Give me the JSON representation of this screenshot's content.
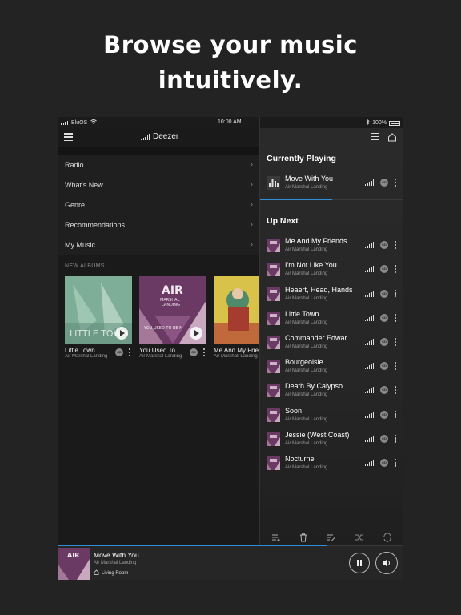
{
  "headline": {
    "line1": "Browse your music",
    "line2": "intuitively."
  },
  "status_bar": {
    "carrier": "BluOS",
    "time": "10:00 AM",
    "battery": "100%"
  },
  "left_panel": {
    "title": "Deezer",
    "menu": [
      {
        "label": "Radio"
      },
      {
        "label": "What's New"
      },
      {
        "label": "Genre"
      },
      {
        "label": "Recommendations"
      },
      {
        "label": "My Music"
      }
    ],
    "new_albums_label": "NEW ALBUMS",
    "albums": [
      {
        "title": "Little Town",
        "artist": "Air Marshal Landing",
        "art_color": "#8fb8a0"
      },
      {
        "title": "You Used To ...",
        "artist": "Air Marshal Landing",
        "art_color": "#8a4a7a"
      },
      {
        "title": "Me And My Frien",
        "artist": "Air Marshall Landing",
        "art_color": "#d8c24a"
      }
    ]
  },
  "right_panel": {
    "currently_playing_label": "Currently Playing",
    "current_track": {
      "name": "Move With You",
      "artist": "Air Marshal Landing"
    },
    "up_next_label": "Up Next",
    "queue": [
      {
        "name": "Me And My Friends",
        "artist": "Air Marshal Landing"
      },
      {
        "name": "I'm Not Like You",
        "artist": "Air Marshal Landing"
      },
      {
        "name": "Heaert, Head, Hands",
        "artist": "Air Marshal Landing"
      },
      {
        "name": "Little Town",
        "artist": "Air Marshal Landing"
      },
      {
        "name": "Commander Edwar...",
        "artist": "Air Marshal Landing"
      },
      {
        "name": "Bourgeoisie",
        "artist": "Air Marshal Landing"
      },
      {
        "name": "Death By Calypso",
        "artist": "Air Marshal Landing"
      },
      {
        "name": "Soon",
        "artist": "Air Marshal Landing"
      },
      {
        "name": "Jessie (West Coast)",
        "artist": "Air Marshal Landing"
      },
      {
        "name": "Nocturne",
        "artist": "Air Marshal Landing"
      }
    ],
    "track_progress": 0.5,
    "toolbar_icons": [
      "add-to-queue-icon",
      "trash-icon",
      "edit-queue-icon",
      "shuffle-icon",
      "repeat-icon"
    ]
  },
  "mini_player": {
    "track": "Move With You",
    "artist": "Air Marshal Landing",
    "room": "Living Room",
    "progress": 0.78,
    "album_art_text": "AIR"
  },
  "colors": {
    "accent": "#2f8fd8",
    "background": "#232323"
  }
}
